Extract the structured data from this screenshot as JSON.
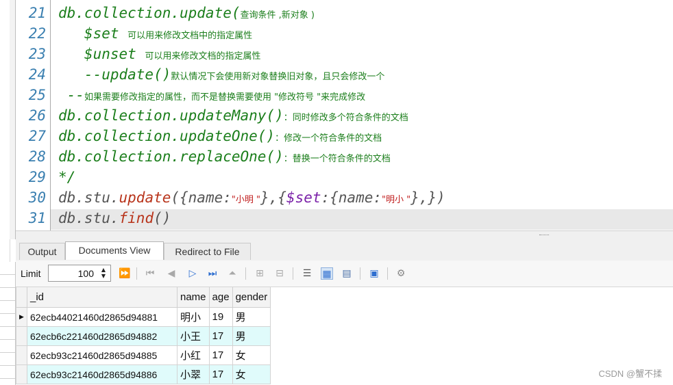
{
  "editor": {
    "line_numbers": [
      "21",
      "22",
      "23",
      "24",
      "25",
      "26",
      "27",
      "28",
      "29",
      "30",
      "31"
    ],
    "lines": [
      {
        "code": "db.collection.update(",
        "comment": "查询条件 ,新对象 )"
      },
      {
        "code": "   $set ",
        "comment": "可以用来修改文档中的指定属性"
      },
      {
        "code": "   $unset ",
        "comment": "可以用来修改文档的指定属性"
      },
      {
        "code": "   --update()",
        "comment": "默认情况下会使用新对象替换旧对象，且只会修改一个"
      },
      {
        "code": " --",
        "comment": "如果需要修改指定的属性，而不是替换需要使用 \"修改符号 \"来完成修改"
      },
      {
        "code": "db.collection.updateMany()",
        "comment": "：同时修改多个符合条件的文档"
      },
      {
        "code": "db.collection.updateOne()",
        "comment": "：修改一个符合条件的文档"
      },
      {
        "code": "db.collection.replaceOne()",
        "comment": "：替换一个符合条件的文档"
      },
      {
        "code": "*/"
      }
    ],
    "line30": {
      "obj": "db.stu.",
      "fn": "update",
      "p1": "({name:",
      "s1": "\"小明 \"",
      "p2": "},{",
      "kw": "$set",
      "p3": ":{name:",
      "s2": "\"明小 \"",
      "p4": "},})"
    },
    "line31": {
      "obj": "db.stu.",
      "fn": "find",
      "p1": "()"
    }
  },
  "tabs": [
    "Output",
    "Documents View",
    "Redirect to File"
  ],
  "active_tab": "Documents View",
  "toolbar": {
    "limit_label": "Limit",
    "limit_value": "100",
    "icons": [
      "next-page-icon",
      "first-page-icon",
      "prev-icon",
      "play-icon",
      "last-icon",
      "up-icon",
      "add-row-icon",
      "delete-row-icon",
      "tree-view-icon",
      "grid-view-icon",
      "text-view-icon",
      "save-icon",
      "settings-icon"
    ]
  },
  "table": {
    "columns": [
      "_id",
      "name",
      "age",
      "gender"
    ],
    "rows": [
      {
        "id": "62ecb44021460d2865d94881",
        "name": "明小",
        "age": "19",
        "gender": "男"
      },
      {
        "id": "62ecb6c221460d2865d94882",
        "name": "小王",
        "age": "17",
        "gender": "男"
      },
      {
        "id": "62ecb93c21460d2865d94885",
        "name": "小红",
        "age": "17",
        "gender": "女"
      },
      {
        "id": "62ecb93c21460d2865d94886",
        "name": "小翠",
        "age": "17",
        "gender": "女"
      }
    ]
  },
  "watermark": "CSDN @蟹不揉",
  "colors": {
    "code_green": "#1b7e1b",
    "line_number_blue": "#3a7fb0",
    "string_red": "#c01d1d",
    "keyword_purple": "#7a20a8",
    "row_alt": "#e0fbfb"
  }
}
